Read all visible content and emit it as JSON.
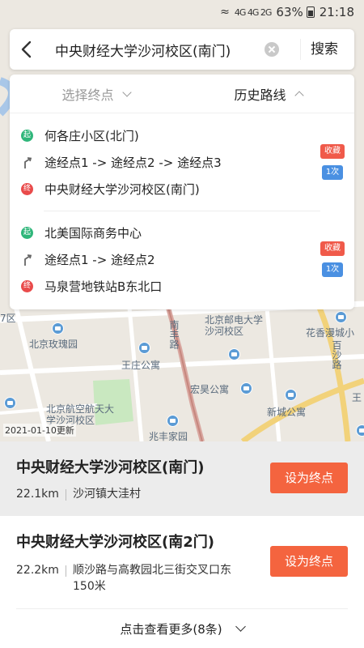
{
  "status_bar": {
    "network": "4G 4G 2G",
    "battery": "63%",
    "time": "21:18"
  },
  "search": {
    "query": "中央财经大学沙河校区(南门)",
    "search_label": "搜索"
  },
  "history_panel": {
    "tabs": [
      {
        "label": "选择终点",
        "active": false
      },
      {
        "label": "历史路线",
        "active": true
      }
    ],
    "routes": [
      {
        "start_marker": "起",
        "start": "何各庄小区(北门)",
        "via": "途经点1 -> 途经点2 -> 途经点3",
        "end_marker": "终",
        "end": "中央财经大学沙河校区(南门)",
        "fav_label": "收藏",
        "count_label": "1次"
      },
      {
        "start_marker": "起",
        "start": "北美国际商务中心",
        "via": "途经点1 -> 途经点2",
        "end_marker": "终",
        "end": "马泉营地铁站B东北口",
        "fav_label": "收藏",
        "count_label": "1次"
      }
    ]
  },
  "map": {
    "labels": [
      "北京邮电大学沙河校区",
      "北京玫瑰园",
      "王庄公寓",
      "南丰路",
      "宏昊公寓",
      "新城公寓",
      "北京航空航天大学沙河校区",
      "兆丰家园",
      "花香漫城小",
      "百沙路",
      "王",
      "7区"
    ],
    "update_date": "2021-01-10更新"
  },
  "results": [
    {
      "title": "中央财经大学沙河校区(南门)",
      "distance": "22.1km",
      "address": "沙河镇大洼村",
      "button": "设为终点"
    },
    {
      "title": "中央财经大学沙河校区(南2门)",
      "distance": "22.2km",
      "address": "顺沙路与高教园北三街交叉口东150米",
      "button": "设为终点"
    }
  ],
  "more_label": "点击查看更多(8条)",
  "colors": {
    "accent": "#f4643f",
    "start_marker": "#2fb67a",
    "end_marker": "#e94b4b",
    "count_badge": "#4a90e2",
    "fav_badge": "#f05a4a"
  }
}
